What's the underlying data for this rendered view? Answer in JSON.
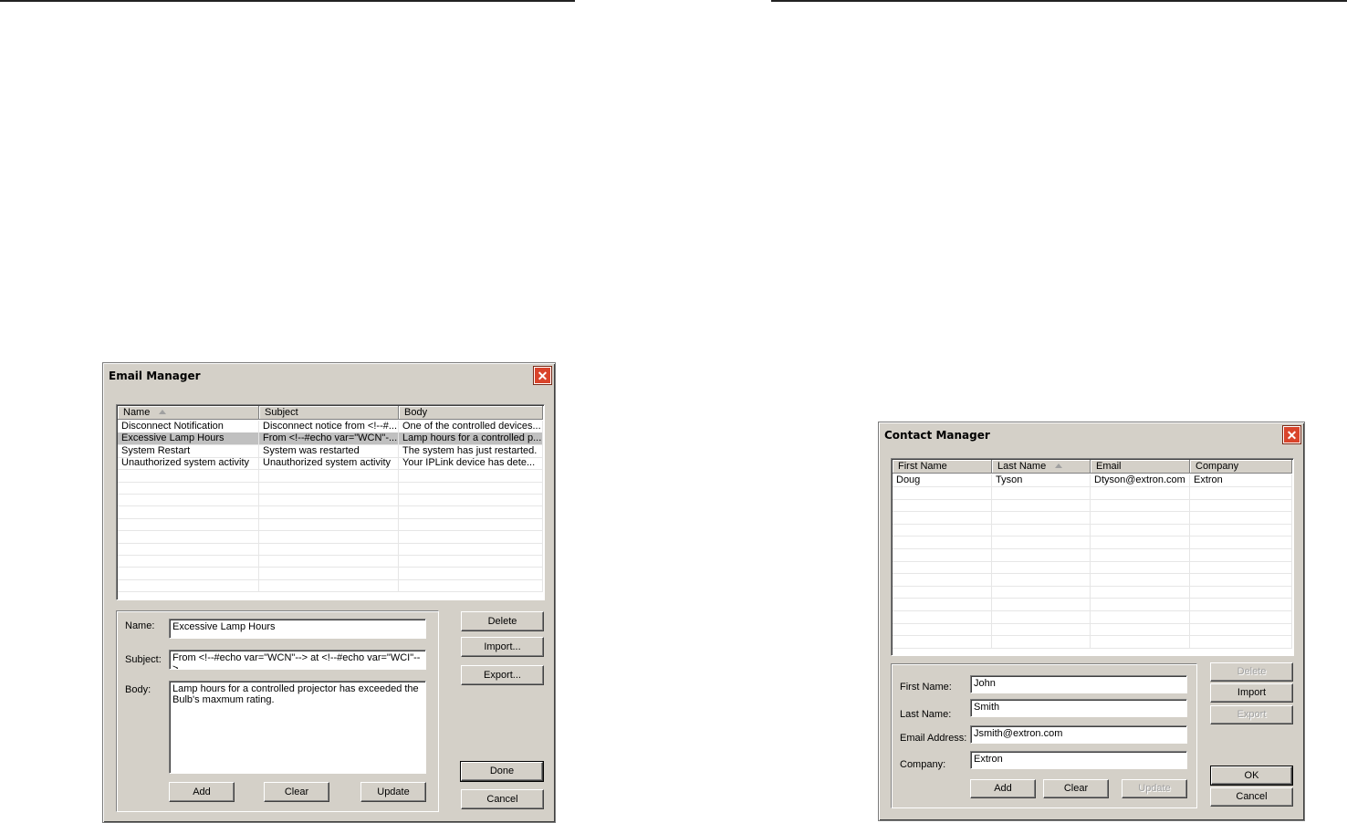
{
  "email_manager": {
    "title": "Email Manager",
    "columns": [
      "Name",
      "Subject",
      "Body"
    ],
    "rows": [
      {
        "name": "Disconnect Notification",
        "subject": "Disconnect notice from <!--#...",
        "body": "One of the controlled devices..."
      },
      {
        "name": "Excessive Lamp Hours",
        "subject": "From <!--#echo var=\"WCN\"-...",
        "body": "Lamp hours for a controlled p..."
      },
      {
        "name": "System Restart",
        "subject": "System was restarted",
        "body": "The system has just restarted."
      },
      {
        "name": "Unauthorized system activity",
        "subject": "Unauthorized system activity",
        "body": "Your IPLink device has dete..."
      }
    ],
    "selected_row": 1,
    "form": {
      "name_label": "Name:",
      "name_value": "Excessive Lamp Hours",
      "subject_label": "Subject:",
      "subject_value": "From <!--#echo var=\"WCN\"--> at <!--#echo var=\"WCI\"-->",
      "body_label": "Body:",
      "body_value": "Lamp hours for a controlled projector has exceeded the Bulb's maxmum rating."
    },
    "buttons": {
      "add": "Add",
      "clear": "Clear",
      "update": "Update",
      "delete": "Delete",
      "import": "Import...",
      "export": "Export...",
      "done": "Done",
      "cancel": "Cancel"
    }
  },
  "contact_manager": {
    "title": "Contact Manager",
    "columns": [
      "First Name",
      "Last Name",
      "Email",
      "Company"
    ],
    "rows": [
      {
        "first": "Doug",
        "last": "Tyson",
        "email": "Dtyson@extron.com",
        "company": "Extron"
      }
    ],
    "form": {
      "first_label": "First Name:",
      "first_value": "John",
      "last_label": "Last Name:",
      "last_value": "Smith",
      "email_label": "Email Address:",
      "email_value": "Jsmith@extron.com",
      "company_label": "Company:",
      "company_value": "Extron"
    },
    "buttons": {
      "add": "Add",
      "clear": "Clear",
      "update": "Update",
      "delete": "Delete",
      "import": "Import",
      "export": "Export",
      "ok": "OK",
      "cancel": "Cancel"
    }
  },
  "colors": {
    "dialog_face": "#d4d0c8",
    "selection": "#c0c0c0",
    "close_button": "#d9442b"
  },
  "icons": [
    "close-icon",
    "sort-ascending-icon"
  ]
}
